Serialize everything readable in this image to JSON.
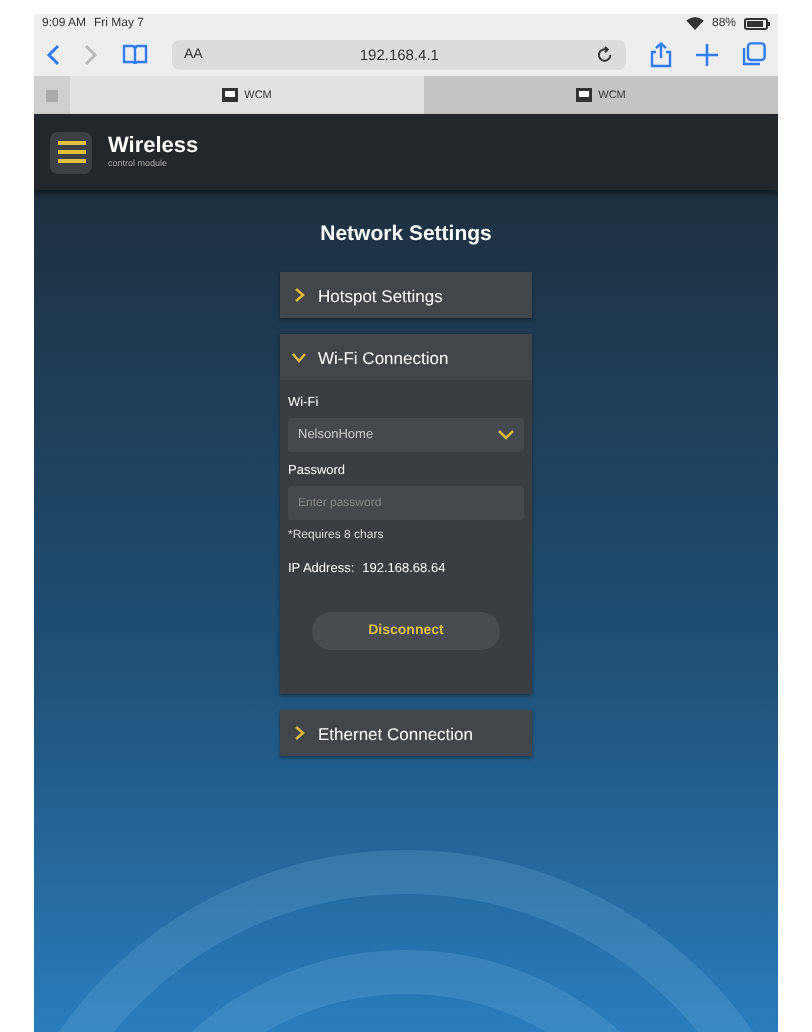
{
  "status_bar": {
    "time": "9:09 AM",
    "date": "Fri May 7",
    "battery": "88%"
  },
  "browser": {
    "text_size_button": "AA",
    "url": "192.168.4.1",
    "tabs": [
      {
        "label": "WCM",
        "selected": true
      },
      {
        "label": "WCM",
        "selected": false
      }
    ]
  },
  "header": {
    "logo_title": "Wireless",
    "logo_subtitle": "control module"
  },
  "page": {
    "title": "Network Settings",
    "sections": [
      {
        "title": "Hotspot Settings",
        "expanded": false
      },
      {
        "title": "Wi-Fi Connection",
        "expanded": true,
        "wifi_label": "Wi-Fi",
        "wifi_value": "NelsonHome",
        "password_label": "Password",
        "password_placeholder": "Enter password",
        "hint": "*Requires 8 chars",
        "ip_label": "IP Address:",
        "ip_value": "192.168.68.64",
        "button": "Disconnect"
      },
      {
        "title": "Ethernet Connection",
        "expanded": false
      }
    ]
  }
}
